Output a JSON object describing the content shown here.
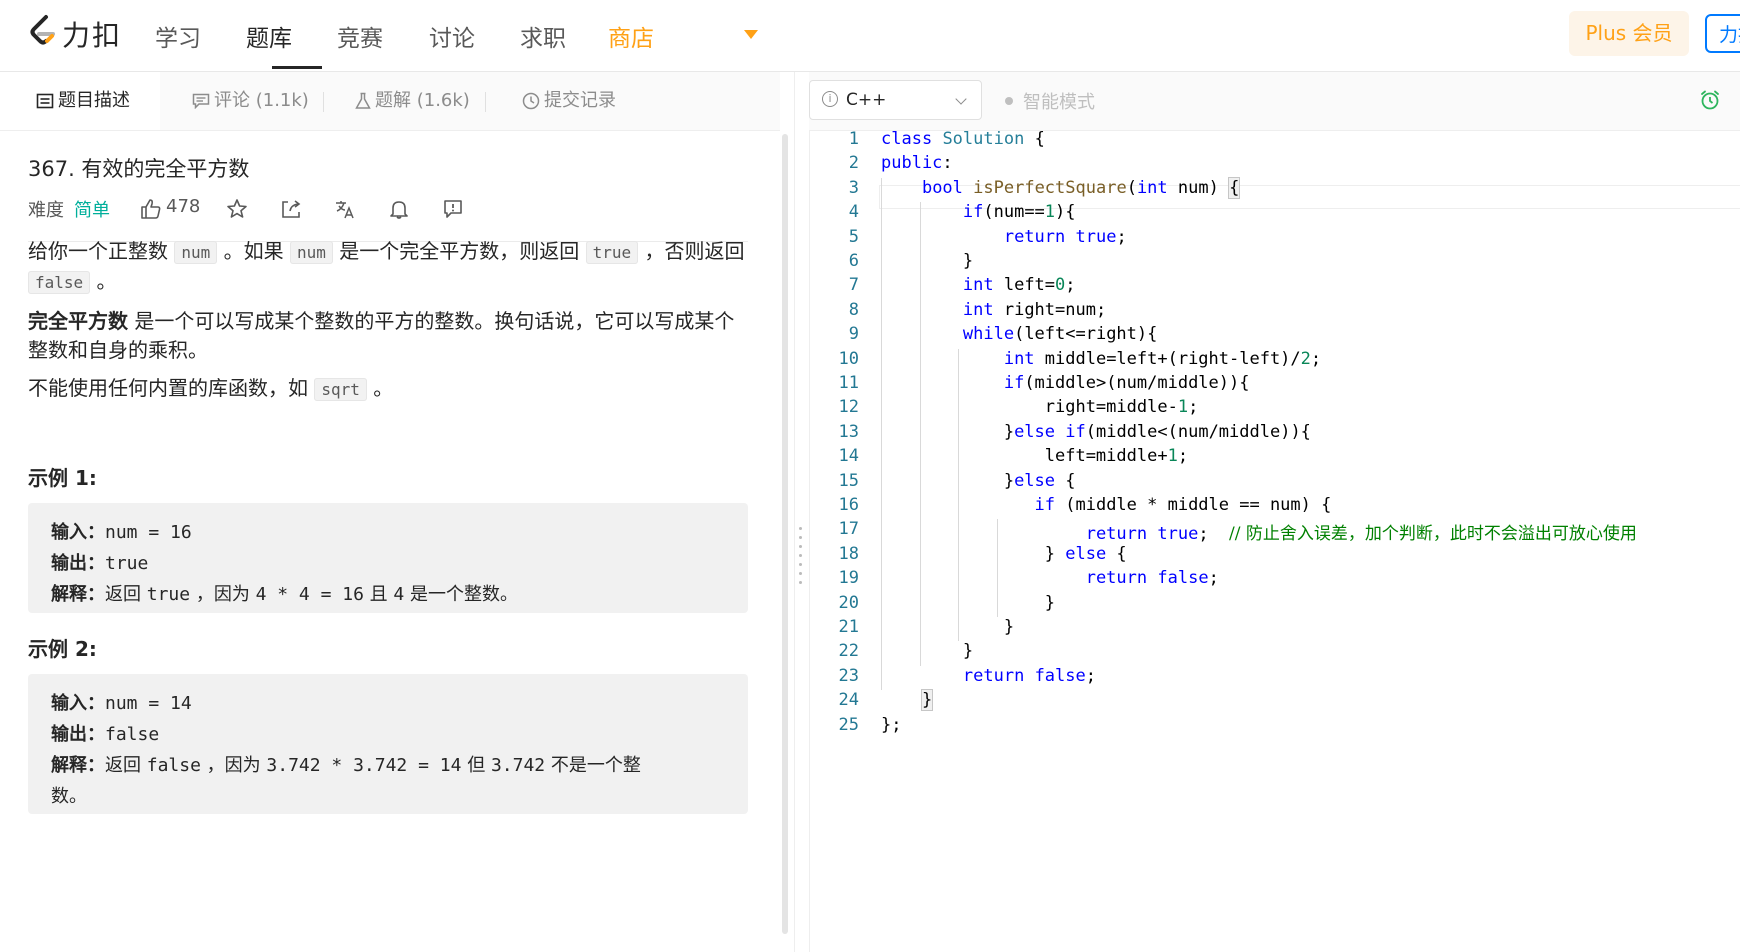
{
  "nav": {
    "brand": "力扣",
    "items": [
      "学习",
      "题库",
      "竞赛",
      "讨论",
      "求职",
      "商店"
    ],
    "active": "题库",
    "plus_label": "Plus 会员",
    "lk_label": "力扣",
    "accent_color": "#ffa116"
  },
  "left_tabs": [
    {
      "label": "题目描述",
      "icon": "description-icon"
    },
    {
      "label": "评论 (1.1k)",
      "icon": "comment-icon"
    },
    {
      "label": "题解 (1.6k)",
      "icon": "flask-icon"
    },
    {
      "label": "提交记录",
      "icon": "clock-icon"
    }
  ],
  "problem": {
    "title": "367. 有效的完全平方数",
    "difficulty_label": "难度",
    "difficulty": "简单",
    "likes": "478",
    "p1_a": "给你一个正整数",
    "p1_code1": "num",
    "p1_b": "。如果",
    "p1_code2": "num",
    "p1_c": "是一个完全平方数，则返回",
    "p1_code3": "true",
    "p1_d": "，否则返回",
    "p1_code4": "false",
    "p1_e": "。",
    "p2_bold": "完全平方数",
    "p2_text": "是一个可以写成某个整数的平方的整数。换句话说，它可以写成某个整数和自身的乘积。",
    "p3_text": "不能使用任何内置的库函数，如",
    "p3_code": "sqrt",
    "p3_end": "。"
  },
  "examples": [
    {
      "title": "示例 1:",
      "input_label": "输入：",
      "input": "num = 16",
      "output_label": "输出：",
      "output": "true",
      "explain_label": "解释：",
      "explain": [
        "返回",
        "true",
        "，因为",
        "4 * 4 = 16",
        "且",
        "4",
        "是一个整数。"
      ]
    },
    {
      "title": "示例 2:",
      "input_label": "输入：",
      "input": "num = 14",
      "output_label": "输出：",
      "output": "false",
      "explain_label": "解释：",
      "explain": [
        "返回",
        "false",
        "，因为",
        "3.742 * 3.742 = 14",
        "但",
        "3.742",
        "不是一个整",
        "数。"
      ]
    }
  ],
  "editor": {
    "language": "C++",
    "smart_mode": "智能模式",
    "code_lines": [
      "class Solution {",
      "public:",
      "    bool isPerfectSquare(int num) {",
      "        if(num==1){",
      "            return true;",
      "        }",
      "        int left=0;",
      "        int right=num;",
      "        while(left<=right){",
      "            int middle=left+(right-left)/2;",
      "            if(middle>(num/middle)){",
      "                right=middle-1;",
      "            }else if(middle<(num/middle)){",
      "                left=middle+1;",
      "            }else {",
      "               if (middle * middle == num) {",
      "                    return true;  // 防止舍入误差，加个判断，此时不会溢出可放心使用",
      "                } else {",
      "                    return false;",
      "                }",
      "            }",
      "        }",
      "        return false;",
      "    }",
      "};"
    ]
  }
}
